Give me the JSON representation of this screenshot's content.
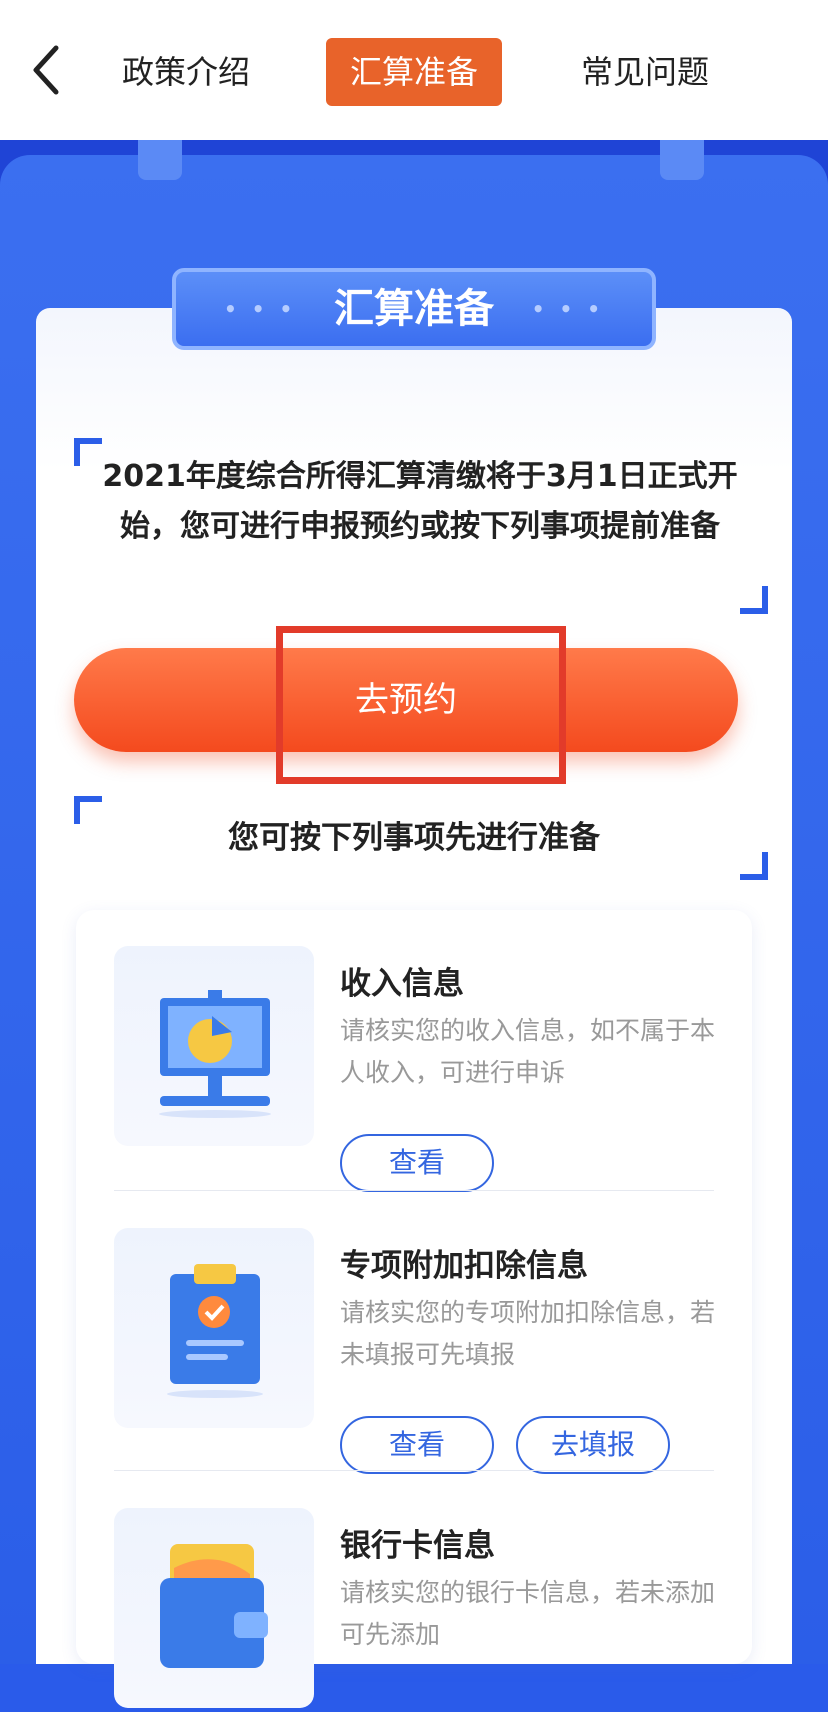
{
  "header": {
    "tabs": [
      {
        "label": "政策介绍",
        "active": false
      },
      {
        "label": "汇算准备",
        "active": true
      },
      {
        "label": "常见问题",
        "active": false
      }
    ]
  },
  "panel": {
    "title": "汇算准备",
    "intro": "2021年度综合所得汇算清缴将于3月1日正式开始，您可进行申报预约或按下列事项提前准备",
    "cta_label": "去预约",
    "subheading": "您可按下列事项先进行准备"
  },
  "items": [
    {
      "title": "收入信息",
      "desc": "请核实您的收入信息，如不属于本人收入，可进行申诉",
      "buttons": [
        "查看"
      ]
    },
    {
      "title": "专项附加扣除信息",
      "desc": "请核实您的专项附加扣除信息，若未填报可先填报",
      "buttons": [
        "查看",
        "去填报"
      ]
    },
    {
      "title": "银行卡信息",
      "desc": "请核实您的银行卡信息，若未添加可先添加",
      "buttons": []
    }
  ],
  "colors": {
    "accent": "#e8632a",
    "primary": "#2b5ee8",
    "cta": "#f44a1e",
    "highlight": "#e23b2a"
  }
}
